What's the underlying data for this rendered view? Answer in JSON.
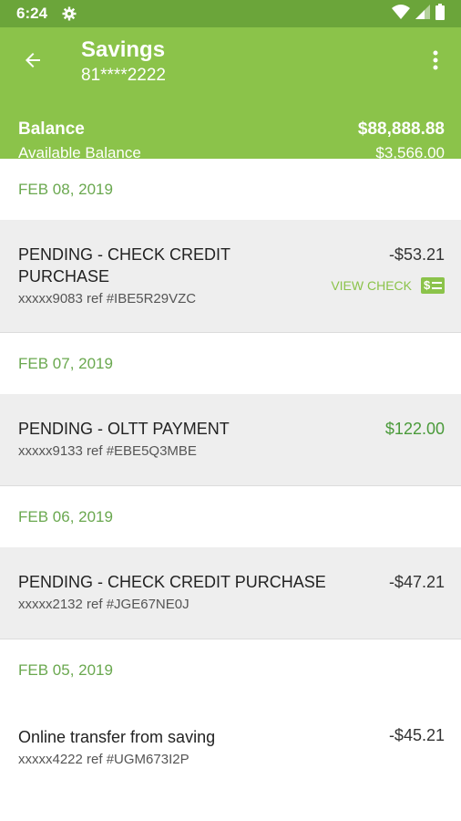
{
  "status": {
    "time": "6:24"
  },
  "header": {
    "title": "Savings",
    "account": "81****2222",
    "balance_label": "Balance",
    "balance_value": "$88,888.88",
    "available_label": "Available Balance",
    "available_value": "$3,566.00"
  },
  "groups": [
    {
      "date": "FEB 08, 2019",
      "txn": {
        "desc": "PENDING - CHECK CREDIT PURCHASE",
        "ref": "xxxxx9083 ref #IBE5R29VZC",
        "amount": "-$53.21",
        "view_check": "VIEW CHECK"
      }
    },
    {
      "date": "FEB 07, 2019",
      "txn": {
        "desc": "PENDING - OLTT PAYMENT",
        "ref": "xxxxx9133 ref #EBE5Q3MBE",
        "amount": "$122.00"
      }
    },
    {
      "date": "FEB 06, 2019",
      "txn": {
        "desc": "PENDING - CHECK CREDIT PURCHASE",
        "ref": "xxxxx2132 ref #JGE67NE0J",
        "amount": "-$47.21"
      }
    },
    {
      "date": "FEB 05, 2019",
      "txn": {
        "desc": "Online transfer from saving",
        "ref": "xxxxx4222 ref #UGM673I2P",
        "amount": "-$45.21"
      }
    }
  ],
  "colors": {
    "appbar": "#8bc34a",
    "statusbar": "#6ba53a",
    "positive": "#4a9a3a"
  }
}
